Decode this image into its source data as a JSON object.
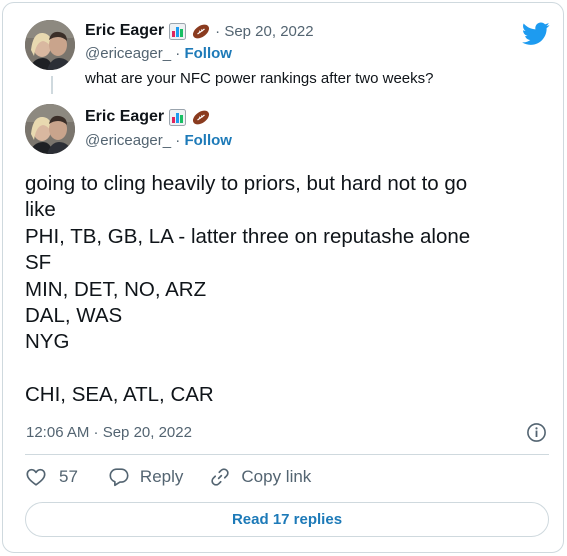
{
  "parent_tweet": {
    "author_name": "Eric Eager",
    "author_emojis": [
      "bar-chart-icon",
      "football-icon"
    ],
    "date": "· Sep 20, 2022",
    "handle": "@ericeager_",
    "separator": " · ",
    "follow_label": "Follow",
    "text": "what are your NFC power rankings after two weeks?"
  },
  "main_tweet": {
    "author_name": "Eric Eager",
    "author_emojis": [
      "bar-chart-icon",
      "football-icon"
    ],
    "handle": "@ericeager_",
    "separator": " · ",
    "follow_label": "Follow",
    "body_lines": [
      "going to cling heavily to priors, but hard not to go",
      "like",
      "PHI, TB, GB, LA - latter three on reputashe alone",
      "SF",
      "MIN, DET, NO, ARZ",
      "DAL, WAS",
      "NYG",
      "",
      "CHI, SEA, ATL, CAR"
    ],
    "timestamp": "12:06 AM · Sep 20, 2022"
  },
  "actions": {
    "like_count": "57",
    "reply_label": "Reply",
    "copy_link_label": "Copy link"
  },
  "read_replies_label": "Read 17 replies",
  "colors": {
    "link_blue": "#1d7ab8",
    "twitter_blue": "#1d9bf0",
    "muted_text": "#536471",
    "border": "#cfd9de"
  }
}
